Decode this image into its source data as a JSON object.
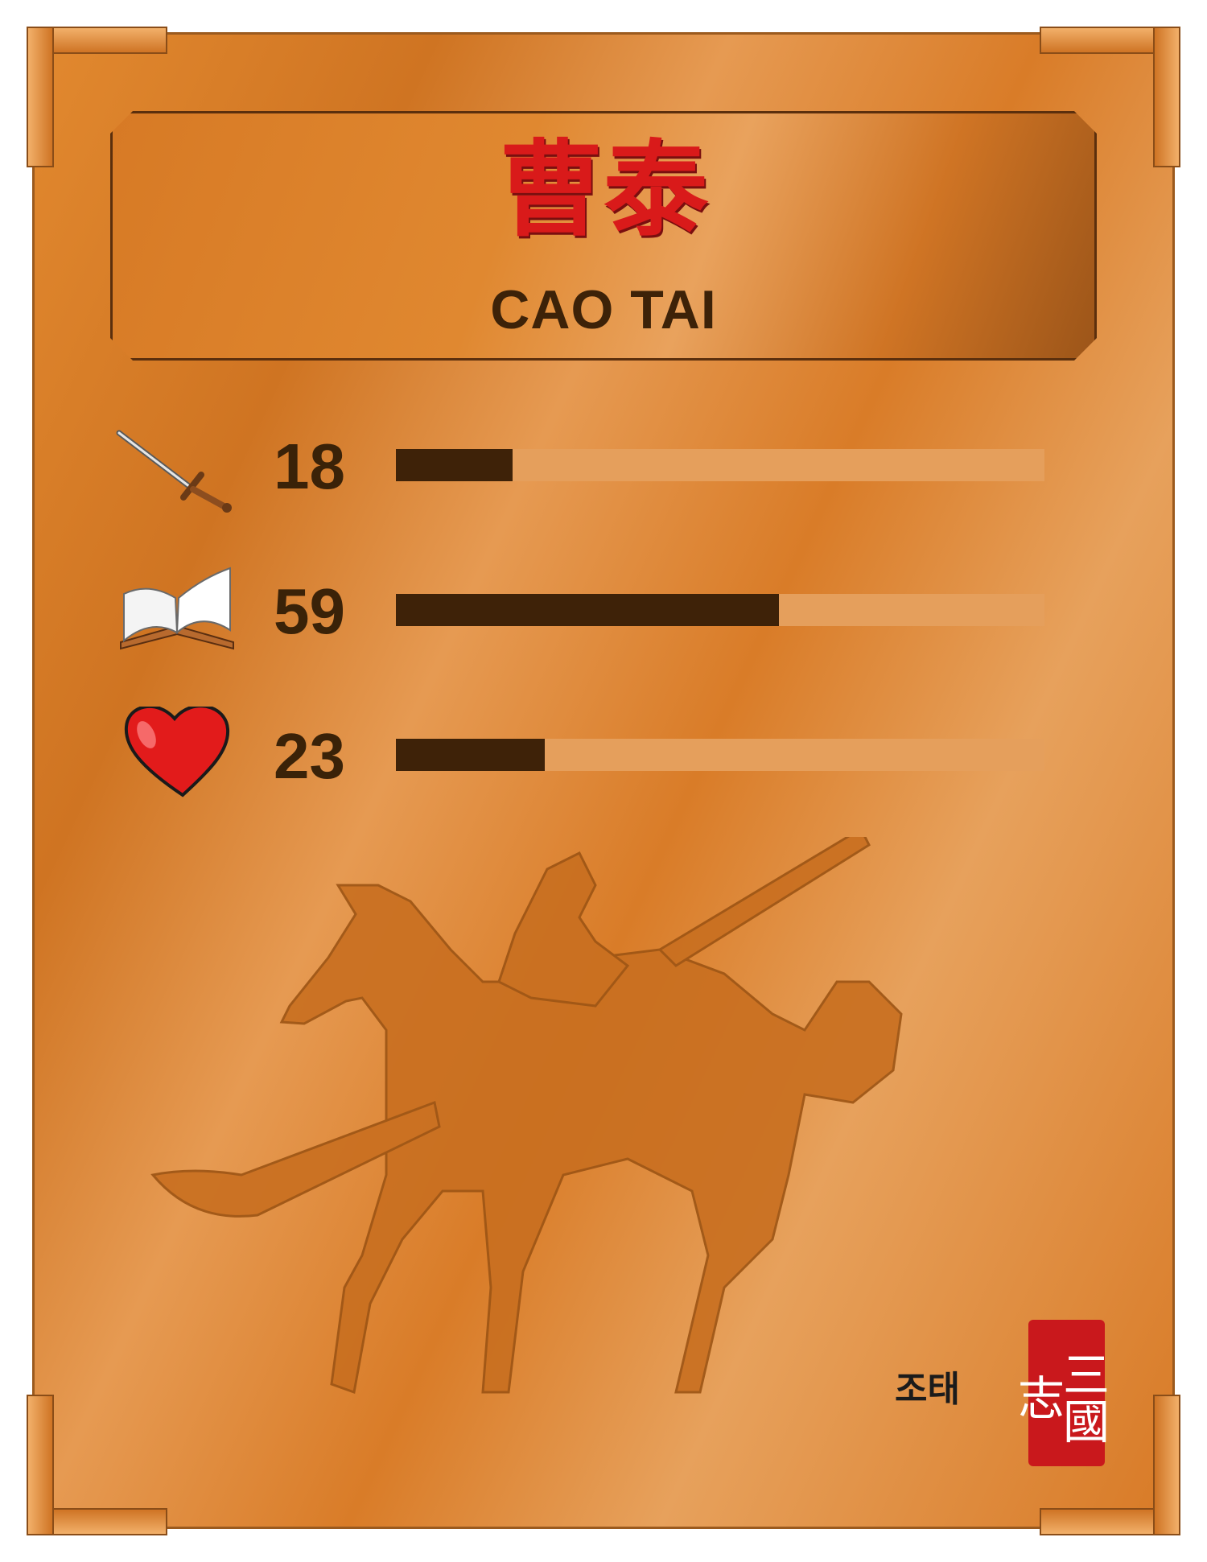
{
  "card": {
    "name_cn": "曹泰",
    "name_en": "CAO TAI",
    "signature_ko": "조태",
    "seal_text": "三國志"
  },
  "stats": [
    {
      "icon": "sword-icon",
      "label_value": "18",
      "value": 18,
      "max": 100
    },
    {
      "icon": "book-icon",
      "label_value": "59",
      "value": 59,
      "max": 100
    },
    {
      "icon": "heart-icon",
      "label_value": "23",
      "value": 23,
      "max": 100
    }
  ],
  "colors": {
    "bar_fill": "#3e2208",
    "bar_track": "#e59f5c",
    "name_cn": "#d91a1a",
    "seal": "#c9181c"
  },
  "illustration": "horse-rider-silhouette"
}
